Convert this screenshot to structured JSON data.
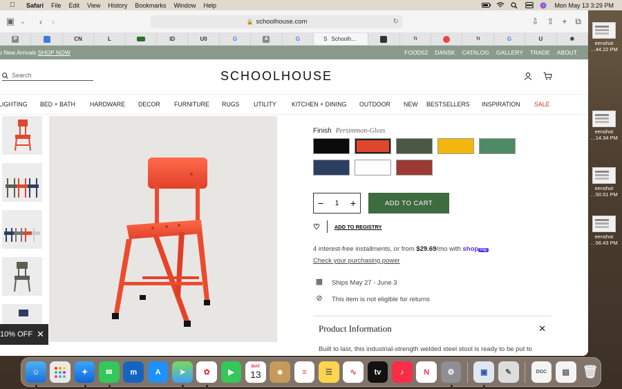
{
  "menubar": {
    "app": "Safari",
    "items": [
      "File",
      "Edit",
      "View",
      "History",
      "Bookmarks",
      "Window",
      "Help"
    ],
    "clock": "Mon May 13  3:29 PM"
  },
  "browser": {
    "url": "schoolhouse.com",
    "active_tab": "Schoolh...",
    "tabs": [
      "P",
      "",
      "CN",
      "L",
      "",
      "ID",
      "U0",
      "G",
      "A",
      "G",
      "",
      "",
      "TI",
      "",
      "TI",
      "G",
      "U",
      ""
    ]
  },
  "site": {
    "promo_text": "o New Arrivals",
    "promo_link": "SHOP NOW",
    "top_links": [
      "FOOD52",
      "DANSK",
      "CATALOG",
      "GALLERY",
      "TRADE",
      "ABOUT"
    ],
    "search_placeholder": "Search",
    "logo": "SCHOOLHOUSE",
    "nav": [
      "LIGHTING",
      "BED + BATH",
      "HARDWARE",
      "DECOR",
      "FURNITURE",
      "RUGS",
      "UTILITY",
      "KITCHEN + DINING",
      "OUTDOOR",
      "NEW",
      "BESTSELLERS",
      "INSPIRATION",
      "SALE"
    ],
    "sale_color": "#d0342c"
  },
  "product": {
    "finish_label": "Finish",
    "finish_value": "Persimmon-Gloss",
    "swatches": [
      {
        "name": "black",
        "color": "#0b0b0b"
      },
      {
        "name": "persimmon",
        "color": "#e0482c"
      },
      {
        "name": "olive",
        "color": "#4a5744"
      },
      {
        "name": "yellow",
        "color": "#f2b60c"
      },
      {
        "name": "green",
        "color": "#4e8a64"
      },
      {
        "name": "navy",
        "color": "#2d3f60"
      },
      {
        "name": "white",
        "color": "#ffffff"
      },
      {
        "name": "red",
        "color": "#9b3a33"
      }
    ],
    "quantity": "1",
    "add_to_cart": "ADD TO CART",
    "add_to_registry": "ADD TO REGISTRY",
    "installments_text": "4 interest-free installments, or from",
    "installments_price": "$29.69",
    "installments_suffix": "/mo with",
    "shop_pay": "shop",
    "shop_pay_badge": "Pay",
    "check_power": "Check your purchasing power",
    "ships": "Ships May 27 - June 3",
    "returns": "This item is not eligible for returns",
    "info_title": "Product Information",
    "description": "Built to last, this industrial-strength welded steel stool is ready to be put to"
  },
  "promo_badge": "10% OFF",
  "desktop": [
    {
      "line1": "",
      "line2": "…44.22 PM",
      "line0": "eenshot"
    },
    {
      "line1": "eenshot",
      "line2": "…14.34 PM"
    },
    {
      "line1": "eenshot",
      "line2": "…50.51 PM"
    },
    {
      "line1": "eenshot",
      "line2": "…56.43 PM"
    }
  ],
  "dock": {
    "calendar_month": "MAY",
    "calendar_day": "13",
    "tv_label": "tv"
  }
}
